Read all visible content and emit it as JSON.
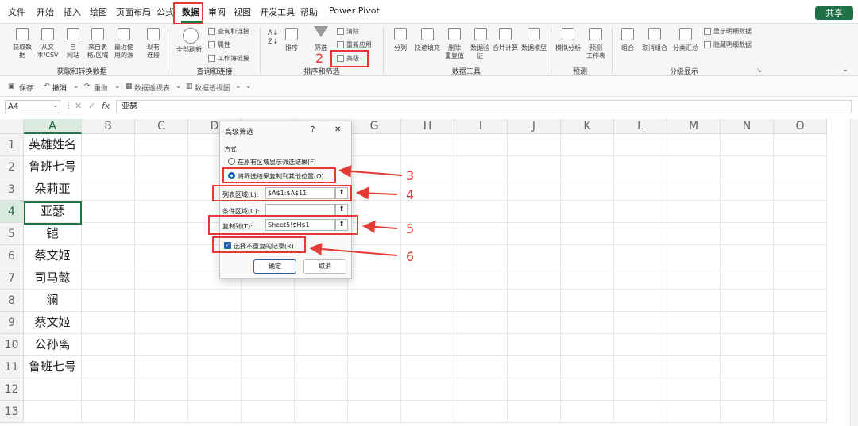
{
  "menu": {
    "file": "文件",
    "start": "开始",
    "insert": "插入",
    "draw": "绘图",
    "layout": "页面布局",
    "formula": "公式",
    "data": "数据",
    "review": "审阅",
    "view": "视图",
    "dev": "开发工具",
    "help": "帮助",
    "powerpivot": "Power Pivot",
    "share": "共享"
  },
  "ribbon": {
    "get_data_1": "获取数",
    "get_data_2": "据",
    "from_text_1": "从文",
    "from_text_2": "本/CSV",
    "from_web_1": "自",
    "from_web_2": "网站",
    "from_table_1": "来自表",
    "from_table_2": "格/区域",
    "recent_1": "最近使",
    "recent_2": "用的源",
    "existing_1": "现有",
    "existing_2": "连接",
    "group_get": "获取和转换数据",
    "refresh_all": "全部刷新",
    "queries": "查询和连接",
    "props": "属性",
    "links": "工作簿链接",
    "group_query": "查询和连接",
    "sort": "排序",
    "filter": "筛选",
    "clear": "清除",
    "reapply": "重新应用",
    "advanced": "高级",
    "group_sort": "排序和筛选",
    "split": "分列",
    "flash": "快速填充",
    "remove_dup_1": "删除",
    "remove_dup_2": "重复值",
    "validate_1": "数据验",
    "validate_2": "证",
    "consolidate": "合并计算",
    "model": "数据模型",
    "group_tools": "数据工具",
    "whatif": "模拟分析",
    "forecast_1": "预测",
    "forecast_2": "工作表",
    "group_forecast": "预测",
    "group_btn": "组合",
    "ungroup": "取消组合",
    "subtotal": "分类汇总",
    "show_detail": "显示明细数据",
    "hide_detail": "隐藏明细数据",
    "group_outline": "分级显示"
  },
  "quick": {
    "save": "保存",
    "undo": "撤消",
    "redo": "重做",
    "pivot": "数据透视表",
    "pivotchart": "数据透视图"
  },
  "formula_bar": {
    "name": "A4",
    "fx": "fx",
    "value": "亚瑟"
  },
  "columns": [
    "A",
    "B",
    "C",
    "D",
    "E",
    "F",
    "G",
    "H",
    "I",
    "J",
    "K",
    "L",
    "M",
    "N",
    "O"
  ],
  "rows": [
    "1",
    "2",
    "3",
    "4",
    "5",
    "6",
    "7",
    "8",
    "9",
    "10",
    "11",
    "12",
    "13"
  ],
  "cells_a": [
    "英雄姓名",
    "鲁班七号",
    "朵莉亚",
    "亚瑟",
    "铠",
    "蔡文姬",
    "司马懿",
    "澜",
    "蔡文姬",
    "公孙离",
    "鲁班七号",
    "",
    ""
  ],
  "dialog": {
    "title": "高级筛选",
    "help": "?",
    "close": "✕",
    "section": "方式",
    "opt1": "在原有区域显示筛选结果(F)",
    "opt2": "将筛选结果复制到其他位置(O)",
    "list_label": "列表区域(L):",
    "list_value": "$A$1:$A$11",
    "cond_label": "条件区域(C):",
    "cond_value": "",
    "copy_label": "复制到(T):",
    "copy_value": "Sheet5!$H$1",
    "unique": "选择不重复的记录(R)",
    "ok": "确定",
    "cancel": "取消"
  },
  "annotations": {
    "n1": "1",
    "n2": "2",
    "n3": "3",
    "n4": "4",
    "n5": "5",
    "n6": "6"
  },
  "colors": {
    "accent": "#1f7a3f",
    "annotation": "#e53935",
    "selected_cell": "#217346"
  }
}
